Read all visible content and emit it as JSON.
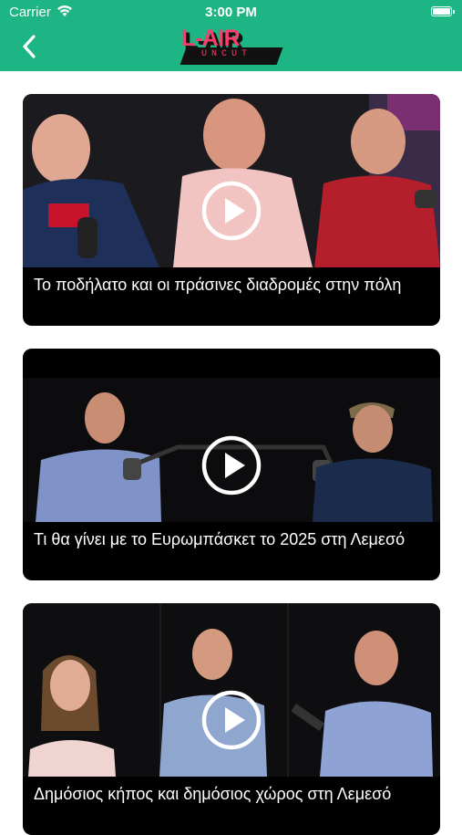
{
  "status_bar": {
    "carrier": "Carrier",
    "time": "3:00 PM"
  },
  "header": {
    "logo_main": "L-AIR",
    "logo_sub": "UNCUT",
    "background_color": "#1db584",
    "accent_color": "#ff3b6b"
  },
  "videos": [
    {
      "title": "Το ποδήλατο και οι πράσινες διαδρομές στην πόλη"
    },
    {
      "title": "Τι θα γίνει με το Ευρωμπάσκετ το 2025 στη Λεμεσό"
    },
    {
      "title": "Δημόσιος κήπος και δημόσιος χώρος στη Λεμεσό"
    }
  ],
  "icons": [
    "wifi-icon",
    "battery-icon",
    "back-chevron-icon",
    "play-icon"
  ]
}
